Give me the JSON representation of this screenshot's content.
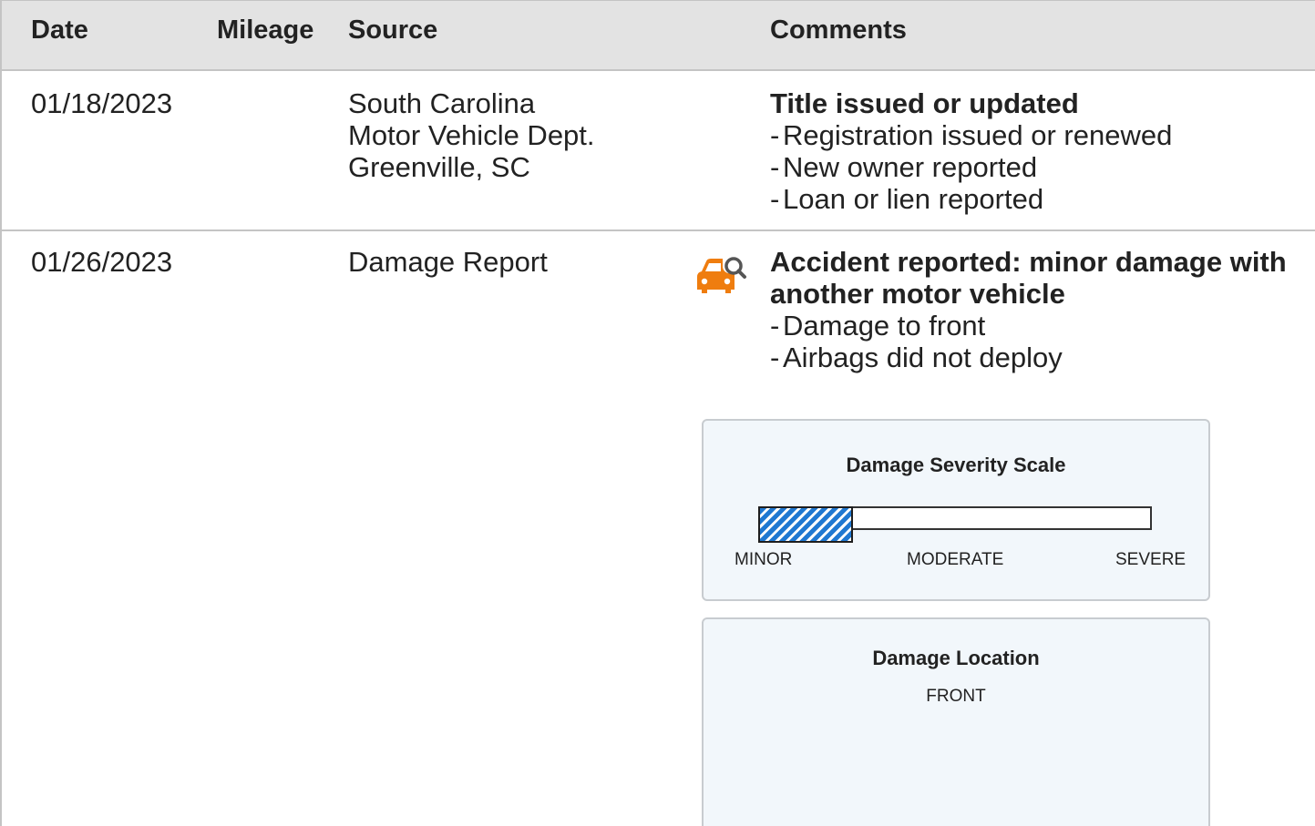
{
  "columns": {
    "date": "Date",
    "mileage": "Mileage",
    "source": "Source",
    "comments": "Comments"
  },
  "records": [
    {
      "date": "01/18/2023",
      "mileage": "",
      "source": [
        "South Carolina",
        "Motor Vehicle Dept.",
        "Greenville, SC"
      ],
      "comment_title": "Title issued or updated",
      "comment_items": [
        "Registration issued or renewed",
        "New owner reported",
        "Loan or lien reported"
      ]
    },
    {
      "date": "01/26/2023",
      "mileage": "",
      "source": [
        "Damage Report"
      ],
      "icon": "car-damage-search-icon",
      "icon_color": "#ef7d0f",
      "comment_title": "Accident reported: minor damage with another motor vehicle",
      "comment_items": [
        "Damage to front",
        "Airbags did not deploy"
      ],
      "severity": {
        "title": "Damage Severity Scale",
        "level_fraction": 0.24,
        "fill_color": "#1f78d1",
        "labels": [
          "MINOR",
          "MODERATE",
          "SEVERE"
        ]
      },
      "location": {
        "title": "Damage Location",
        "value": "FRONT"
      }
    }
  ],
  "dash": "-"
}
